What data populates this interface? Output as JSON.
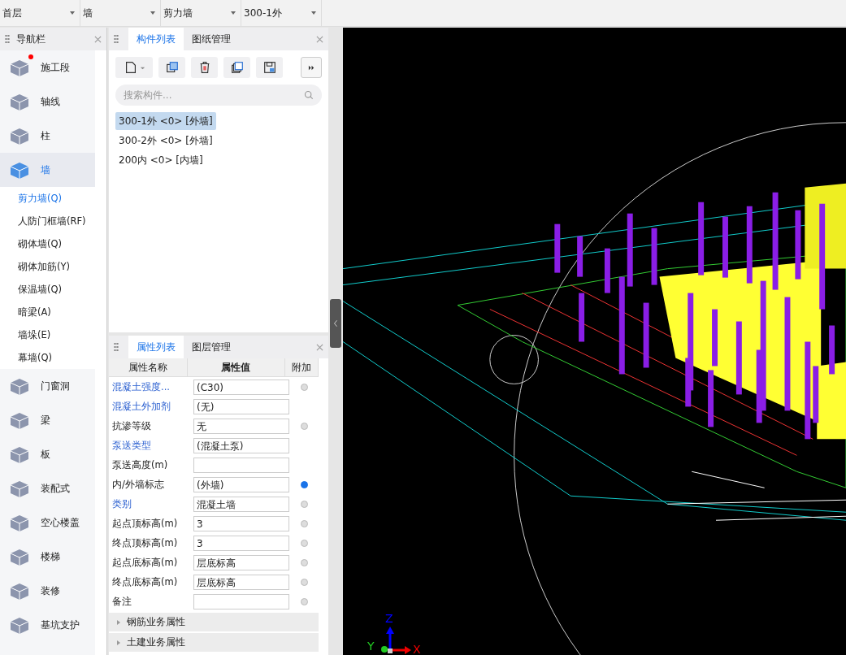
{
  "top_selectors": [
    {
      "value": "首层"
    },
    {
      "value": "墙"
    },
    {
      "value": "剪力墙"
    },
    {
      "value": "300-1外"
    }
  ],
  "nav": {
    "title": "导航栏",
    "items": [
      {
        "label": "施工段",
        "selected": false,
        "badge": true
      },
      {
        "label": "轴线",
        "selected": false,
        "badge": false
      },
      {
        "label": "柱",
        "selected": false,
        "badge": false
      },
      {
        "label": "墙",
        "selected": true,
        "badge": false,
        "children": [
          {
            "label": "剪力墙(Q)",
            "selected": true
          },
          {
            "label": "人防门框墙(RF)",
            "selected": false
          },
          {
            "label": "砌体墙(Q)",
            "selected": false
          },
          {
            "label": "砌体加筋(Y)",
            "selected": false
          },
          {
            "label": "保温墙(Q)",
            "selected": false
          },
          {
            "label": "暗梁(A)",
            "selected": false
          },
          {
            "label": "墙垛(E)",
            "selected": false
          },
          {
            "label": "幕墙(Q)",
            "selected": false
          }
        ]
      },
      {
        "label": "门窗洞",
        "selected": false,
        "badge": false
      },
      {
        "label": "梁",
        "selected": false,
        "badge": false
      },
      {
        "label": "板",
        "selected": false,
        "badge": false
      },
      {
        "label": "装配式",
        "selected": false,
        "badge": false
      },
      {
        "label": "空心楼盖",
        "selected": false,
        "badge": false
      },
      {
        "label": "楼梯",
        "selected": false,
        "badge": false
      },
      {
        "label": "装修",
        "selected": false,
        "badge": false
      },
      {
        "label": "基坑支护",
        "selected": false,
        "badge": false
      }
    ]
  },
  "component_panel": {
    "tabs": [
      {
        "label": "构件列表",
        "selected": true
      },
      {
        "label": "图纸管理",
        "selected": false
      }
    ],
    "search": {
      "placeholder": "搜索构件..."
    },
    "items": [
      {
        "label": "300-1外 <0> [外墙]",
        "selected": true
      },
      {
        "label": "300-2外 <0> [外墙]",
        "selected": false
      },
      {
        "label": "200内 <0> [内墙]",
        "selected": false
      }
    ]
  },
  "property_panel": {
    "tabs": [
      {
        "label": "属性列表",
        "selected": true
      },
      {
        "label": "图层管理",
        "selected": false
      }
    ],
    "columns": [
      "属性名称",
      "属性值",
      "附加"
    ],
    "rows": [
      {
        "name": "混凝土强度...",
        "value": "(C30)",
        "public": true,
        "attached": false
      },
      {
        "name": "混凝土外加剂",
        "value": "(无)",
        "public": true
      },
      {
        "name": "抗渗等级",
        "value": "无",
        "public": false,
        "attached": false
      },
      {
        "name": "泵送类型",
        "value": "(混凝土泵)",
        "public": true
      },
      {
        "name": "泵送高度(m)",
        "value": "",
        "public": false
      },
      {
        "name": "内/外墙标志",
        "value": "(外墙)",
        "public": false,
        "attached": true
      },
      {
        "name": "类别",
        "value": "混凝土墙",
        "public": true,
        "attached": false
      },
      {
        "name": "起点顶标高(m)",
        "value": "3",
        "public": false,
        "attached": false
      },
      {
        "name": "终点顶标高(m)",
        "value": "3",
        "public": false,
        "attached": false
      },
      {
        "name": "起点底标高(m)",
        "value": "层底标高",
        "public": false,
        "attached": false
      },
      {
        "name": "终点底标高(m)",
        "value": "层底标高",
        "public": false,
        "attached": false
      },
      {
        "name": "备注",
        "value": "",
        "public": false,
        "attached": false
      }
    ],
    "groups": [
      {
        "label": "钢筋业务属性",
        "expanded": false
      },
      {
        "label": "土建业务属性",
        "expanded": false
      }
    ]
  },
  "viewport": {
    "axes": [
      "Z",
      "Y",
      "X"
    ]
  }
}
